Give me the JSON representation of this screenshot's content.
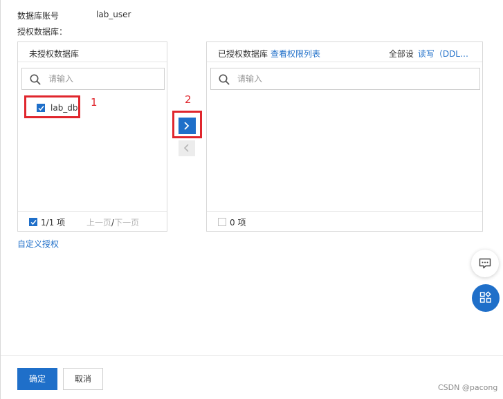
{
  "account": {
    "label": "数据库账号",
    "value": "lab_user"
  },
  "grant_label": "授权数据库：",
  "left_panel": {
    "title": "未授权数据库",
    "search_placeholder": "请输入",
    "items": [
      {
        "label": "lab_db",
        "checked": true
      }
    ],
    "footer": {
      "count": "1/1 项",
      "prev": "上一页",
      "separator": "/",
      "next": "下一页"
    }
  },
  "right_panel": {
    "title": "已授权数据库",
    "title_link": "查看权限列表",
    "scope_label": "全部设",
    "permission_link": "读写（DDL…",
    "search_placeholder": "请输入",
    "footer": {
      "count": "0 项"
    }
  },
  "annotations": {
    "step1": "1",
    "step2": "2"
  },
  "custom_grant_link": "自定义授权",
  "buttons": {
    "ok": "确定",
    "cancel": "取消"
  },
  "watermark": "CSDN @pacong",
  "colors": {
    "accent": "#1f6fc9",
    "highlight_border": "#e0262d",
    "border": "#d9d9d9"
  },
  "icons": {
    "search": "search-icon",
    "arrow_right": "chevron-right-icon",
    "arrow_left": "chevron-left-icon",
    "chat": "chat-icon",
    "apps": "apps-icon",
    "check": "check-icon"
  }
}
